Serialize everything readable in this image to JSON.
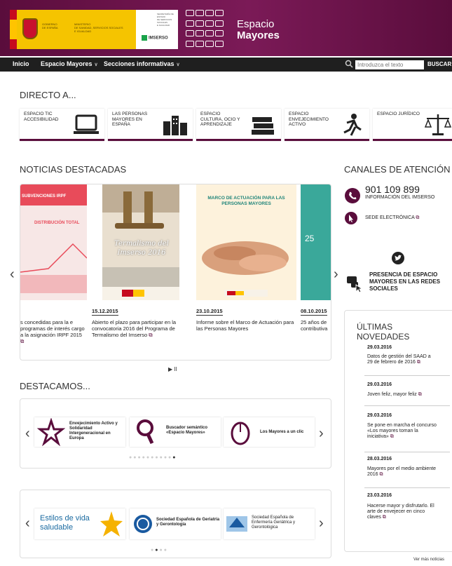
{
  "header": {
    "gov": {
      "line1": "GOBIERNO",
      "line2": "DE ESPAÑA",
      "ministry": [
        "MINISTERIO",
        "DE SANIDAD, SERVICIOS SOCIALES",
        "E IGUALDAD"
      ],
      "secretaria": [
        "SECRETARÍA DE ESTADO",
        "DE SERVICIOS SOCIALES",
        "E IGUALDAD"
      ]
    },
    "imserso": "IMSERSO",
    "site_title_line1": "Espacio",
    "site_title_line2": "Mayores"
  },
  "nav": {
    "items": [
      "Inicio",
      "Espacio Mayores",
      "Secciones informativas"
    ],
    "search_placeholder": "Introduzca el texto",
    "search_button": "BUSCAR"
  },
  "directo": {
    "title": "DIRECTO A...",
    "tiles": [
      {
        "label": "ESPACIO TIC ACCESIBILIDAD",
        "icon": "laptop-icon"
      },
      {
        "label": "LAS PERSONAS MAYORES EN ESPAÑA",
        "icon": "buildings-icon"
      },
      {
        "label": "ESPACIO CULTURA, OCIO Y APRENDIZAJE",
        "icon": "books-icon"
      },
      {
        "label": "ESPACIO ENVEJECIMIENTO ACTIVO",
        "icon": "runner-icon"
      },
      {
        "label": "ESPACIO JURÍDICO",
        "icon": "scales-icon"
      }
    ]
  },
  "noticias": {
    "title": "NOTICIAS DESTACADAS",
    "items": [
      {
        "date": "",
        "text": "s concedidas para la e programas de interés cargo a la asignación IRPF 2015",
        "img_title": "SUBVENCIONES IRPF",
        "img_sub": "DISTRIBUCIÓN TOTAL"
      },
      {
        "date": "15.12.2015",
        "text": "Abierto el plazo para participar en la convocatoria 2016 del Programa de Termalismo del Imserso",
        "img_title": "Termalismo del Imserso 2016"
      },
      {
        "date": "23.10.2015",
        "text": "Informe sobre el Marco de Actuación para las Personas Mayores",
        "img_title": "MARCO DE ACTUACIÓN PARA LAS PERSONAS MAYORES"
      },
      {
        "date": "08.10.2015",
        "text": "25 años de contributiva",
        "img_title": "25"
      }
    ],
    "controls": "▶ II"
  },
  "canales": {
    "title": "CANALES DE ATENCIÓN",
    "phone": "901 109 899",
    "phone_label": "INFORMACIÓN DEL IMSERSO",
    "sede": "SEDE ELECTRÓNICA",
    "redes": "PRESENCIA DE ESPACIO MAYORES EN LAS REDES SOCIALES"
  },
  "ultimas": {
    "title_line1": "ÚLTIMAS",
    "title_line2": "NOVEDADES",
    "items": [
      {
        "date": "29.03.2016",
        "text": "Datos de gestión del SAAD a 29 de febrero de 2016"
      },
      {
        "date": "29.03.2016",
        "text": "Joven feliz, mayor feliz"
      },
      {
        "date": "29.03.2016",
        "text": "Se pone en marcha el concurso «Los mayores toman la iniciativa»"
      },
      {
        "date": "28.03.2016",
        "text": "Mayores por el medio ambiente 2016"
      },
      {
        "date": "23.03.2016",
        "text": "Hacerse mayor y disfrutarlo. El arte de envejecer en cinco claves"
      }
    ],
    "more": "Ver más noticias"
  },
  "destacamos": {
    "title": "DESTACAMOS...",
    "items": [
      {
        "label": "Envejecimiento Activo y Solidaridad Intergeneracional en Europa"
      },
      {
        "label": "Buscador semántico «Espacio Mayores»"
      },
      {
        "label": "Los Mayores a un clic"
      }
    ],
    "partners": [
      {
        "label": "Estilos de vida saludable"
      },
      {
        "label": "Sociedad Española de Geriatría y Gerontología"
      },
      {
        "label": "Sociedad Española de Enfermería Geriátrica y Gerontológica"
      }
    ]
  },
  "colors": {
    "brand": "#5a0d3c",
    "nav": "#1f1f1f",
    "gov_yellow": "#f5c400"
  }
}
